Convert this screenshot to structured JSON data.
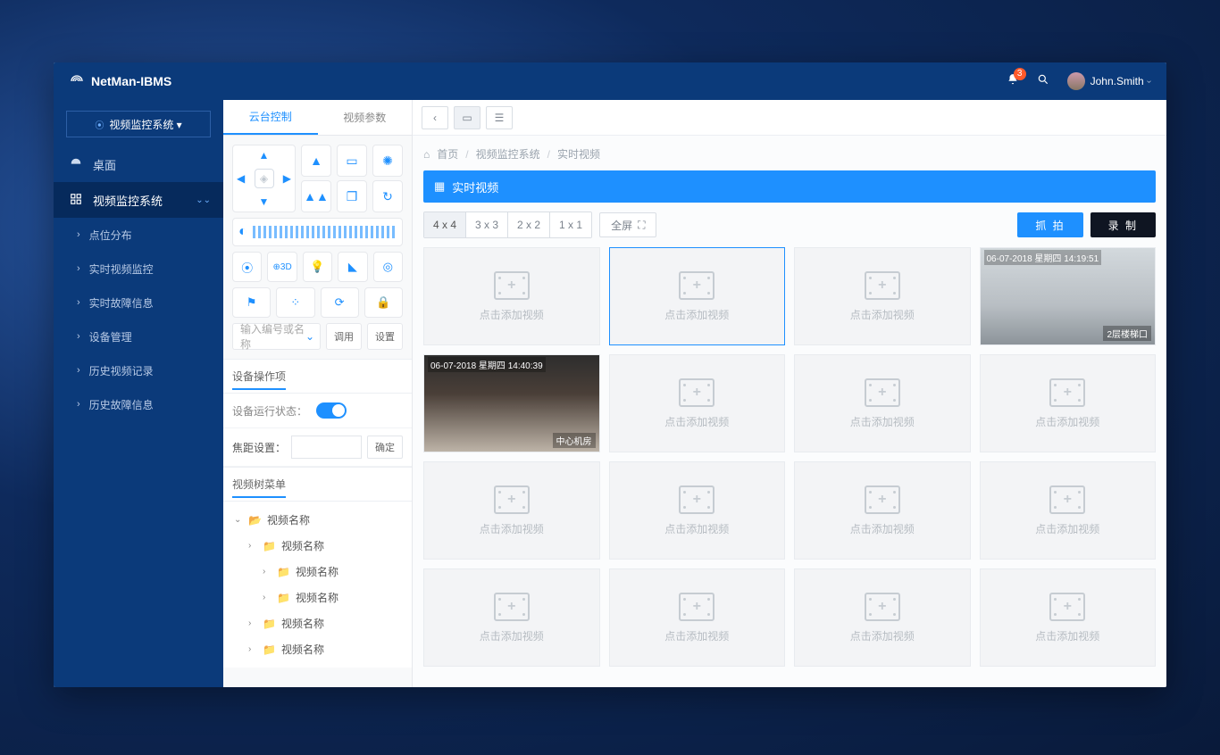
{
  "brand": "NetMan-IBMS",
  "topbar": {
    "notification_count": "3",
    "user_name": "John.Smith"
  },
  "sidebar": {
    "selector": "视频监控系统 ▾",
    "items": [
      {
        "label": "桌面"
      },
      {
        "label": "视频监控系统"
      }
    ],
    "subs": [
      {
        "label": "点位分布"
      },
      {
        "label": "实时视频监控"
      },
      {
        "label": "实时故障信息"
      },
      {
        "label": "设备管理"
      },
      {
        "label": "历史视频记录"
      },
      {
        "label": "历史故障信息"
      }
    ]
  },
  "cp": {
    "tabs": {
      "ptz": "云台控制",
      "params": "视频参数"
    },
    "input_placeholder": "输入编号或名称",
    "btn_call": "调用",
    "btn_set": "设置",
    "section_device": "设备操作项",
    "label_state": "设备运行状态：",
    "label_focus": "焦距设置：",
    "btn_confirm": "确定",
    "section_tree": "视频树菜单",
    "tree": [
      {
        "level": 1,
        "label": "视频名称",
        "open": true
      },
      {
        "level": 2,
        "label": "视频名称"
      },
      {
        "level": 3,
        "label": "视频名称"
      },
      {
        "level": 3,
        "label": "视频名称"
      },
      {
        "level": 2,
        "label": "视频名称"
      },
      {
        "level": 2,
        "label": "视频名称"
      }
    ]
  },
  "main": {
    "breadcrumb": {
      "home": "首页",
      "b1": "视频监控系统",
      "b2": "实时视频"
    },
    "page_title": "实时视频",
    "layouts": {
      "g44": "4 x 4",
      "g33": "3 x 3",
      "g22": "2 x 2",
      "g11": "1 x 1"
    },
    "fullscreen": "全屏",
    "btn_capture": "抓 拍",
    "btn_record": "录 制",
    "placeholder": "点击添加视频",
    "video1": {
      "ts": "06-07-2018 星期四 14:40:39",
      "cap": "中心机房"
    },
    "video2": {
      "ts": "06-07-2018 星期四 14:19:51",
      "cap": "2层楼梯口"
    }
  }
}
